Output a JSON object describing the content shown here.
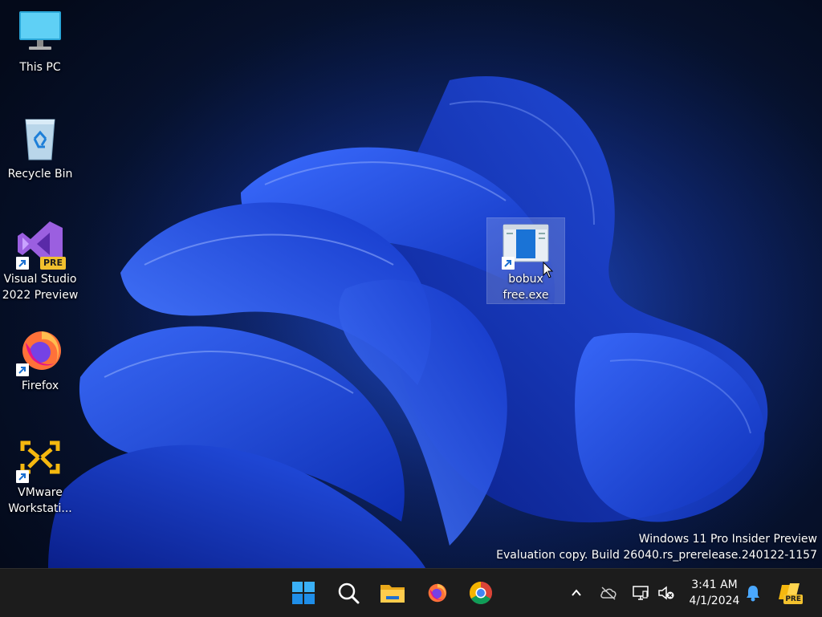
{
  "desktop": {
    "icons": [
      {
        "label": "This PC",
        "icon": "monitor-icon"
      },
      {
        "label": "Recycle Bin",
        "icon": "recycle-bin-icon"
      },
      {
        "label": "Visual Studio 2022 Preview",
        "icon": "visual-studio-preview-icon",
        "badge": "PRE"
      },
      {
        "label": "Firefox",
        "icon": "firefox-icon"
      },
      {
        "label": "VMware Workstati...",
        "icon": "vmware-icon"
      },
      {
        "label": "bobux free.exe",
        "icon": "application-window-icon"
      }
    ]
  },
  "watermark": {
    "line1": "Windows 11 Pro Insider Preview",
    "line2": "Evaluation copy. Build 26040.rs_prerelease.240122-1157"
  },
  "taskbar": {
    "pinned": [
      {
        "name": "start",
        "icon": "windows-logo-icon"
      },
      {
        "name": "search",
        "icon": "search-icon"
      },
      {
        "name": "file-explorer",
        "icon": "folder-icon"
      },
      {
        "name": "firefox",
        "icon": "firefox-icon"
      },
      {
        "name": "chrome",
        "icon": "chrome-icon"
      }
    ],
    "tray": {
      "time": "3:41 AM",
      "date": "4/1/2024",
      "copilot_badge": "PRE",
      "icons": [
        "chevron-up-icon",
        "onedrive-offline-icon",
        "network-icon",
        "volume-muted-icon",
        "bell-icon",
        "copilot-icon"
      ]
    }
  },
  "colors": {
    "taskbar_bg": "#1c1c1c",
    "accent": "#0a74da",
    "wallpaper_primary": "#1a4fd6"
  }
}
